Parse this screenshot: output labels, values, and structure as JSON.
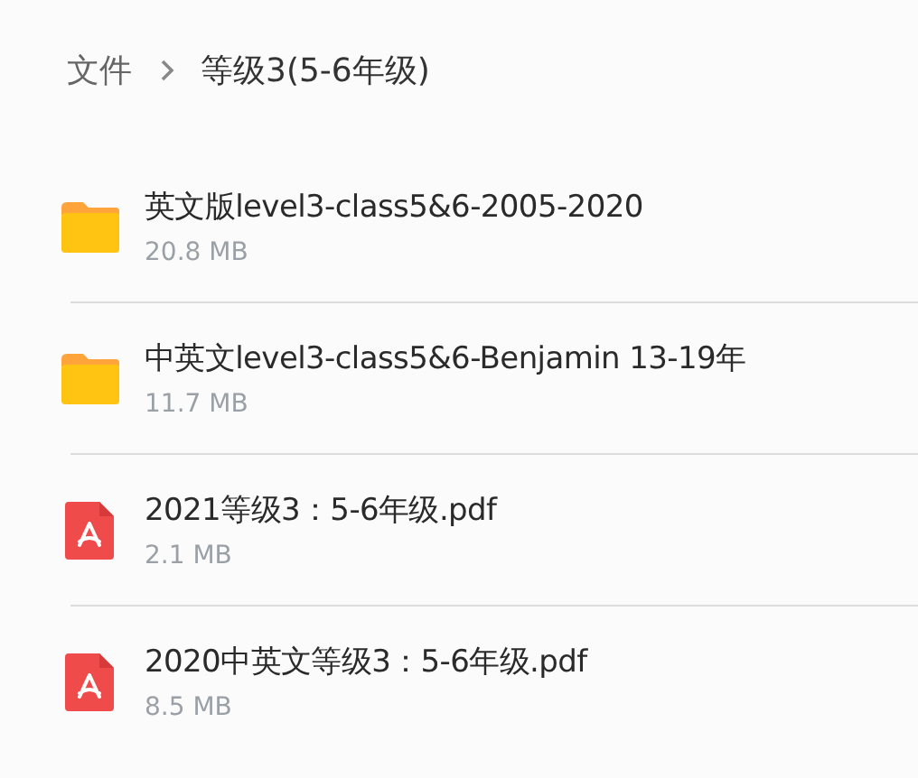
{
  "breadcrumb": [
    {
      "label": "文件",
      "current": false
    },
    {
      "label": "等级3(5-6年级)",
      "current": true
    }
  ],
  "files": [
    {
      "kind": "folder",
      "name": "英文版level3-class5&6-2005-2020",
      "size": "20.8 MB"
    },
    {
      "kind": "folder",
      "name": "中英文level3-class5&6-Benjamin 13-19年",
      "size": "11.7 MB"
    },
    {
      "kind": "pdf",
      "name": "2021等级3：5-6年级.pdf",
      "size": "2.1 MB"
    },
    {
      "kind": "pdf",
      "name": "2020中英文等级3：5-6年级.pdf",
      "size": "8.5 MB"
    }
  ]
}
